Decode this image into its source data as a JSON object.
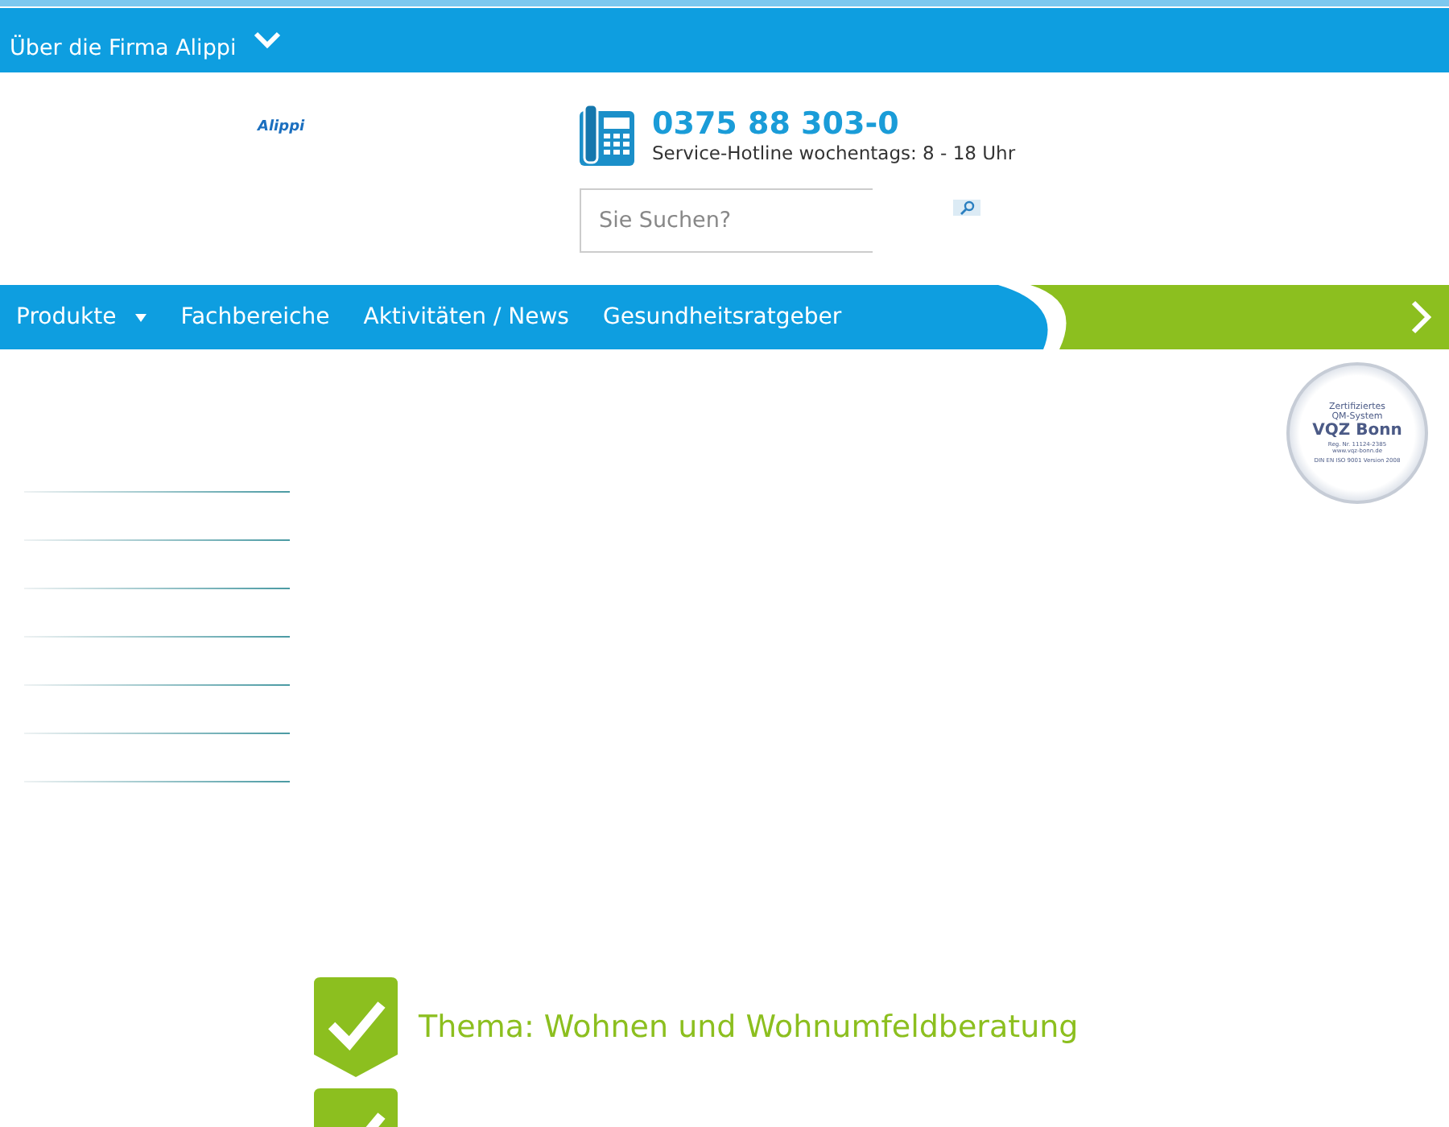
{
  "top_bar": {
    "menu_label": "Über die Firma Alippi"
  },
  "header": {
    "logo": "Alippi",
    "phone": "0375 88 303-0",
    "hotline": "Service-Hotline wochentags: 8 - 18 Uhr",
    "search": {
      "placeholder": "Sie Suchen?"
    }
  },
  "nav": {
    "items": [
      {
        "label": "Produkte",
        "has_submenu": true
      },
      {
        "label": "Fachbereiche",
        "has_submenu": false
      },
      {
        "label": "Aktivitäten / News",
        "has_submenu": false
      },
      {
        "label": "Gesundheitsratgeber",
        "has_submenu": false
      }
    ]
  },
  "certificate": {
    "line_1": "Zertifiziertes",
    "line_2": "QM-System",
    "title": "VQZ Bonn",
    "reg": "Reg. Nr. 11124-2385",
    "url": "www.vqz-bonn.de",
    "norm": "DIN EN ISO 9001 Version 2008"
  },
  "topics": [
    {
      "kind": "labeled",
      "label": "Thema: Wohnen und Wohnumfeldberatung"
    },
    {
      "kind": "cut"
    }
  ]
}
